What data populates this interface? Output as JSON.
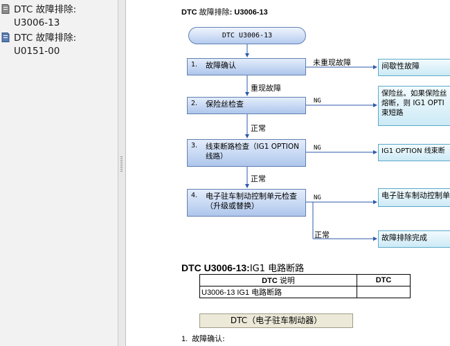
{
  "sidebar": {
    "items": [
      {
        "label": "DTC 故障排除:\nU3006-13"
      },
      {
        "label": "DTC 故障排除:\nU0151-00"
      }
    ]
  },
  "document": {
    "title_code": "DTC",
    "title_text": " 故障排除",
    "title_suffix": ": U3006-13",
    "flowchart": {
      "start": "DTC U3006-13",
      "steps": [
        {
          "num": "1.",
          "label": "故障确认"
        },
        {
          "num": "2.",
          "label": "保险丝检查"
        },
        {
          "num": "3.",
          "label": "线束断路检查（IG1 OPTION\n线路）"
        },
        {
          "num": "4.",
          "label": "电子驻车制动控制单元检查\n（升级或替换）"
        }
      ],
      "results": [
        "间歇性故障",
        "保险丝。如果保险丝\n熔断，则 IG1 OPTI\n束短路",
        "IG1 OPTION 线束断",
        "电子驻车制动控制单",
        "故障排除完成"
      ],
      "labels": {
        "no_repro": "未重现故障",
        "repro": "重现故障",
        "ng": "NG",
        "ok": "正常"
      }
    },
    "section": {
      "code": "DTC U3006-13",
      "sep": ":",
      "desc": "IG1 电路断路"
    },
    "dtc_table": {
      "headers": [
        "DTC",
        "说明",
        "DTC"
      ],
      "row": [
        "U3006-13 IG1 电路断路",
        ""
      ]
    },
    "dtc_button": "DTC（电子驻车制动器）",
    "step1": {
      "num": "1.",
      "text": "故障确认:"
    }
  }
}
